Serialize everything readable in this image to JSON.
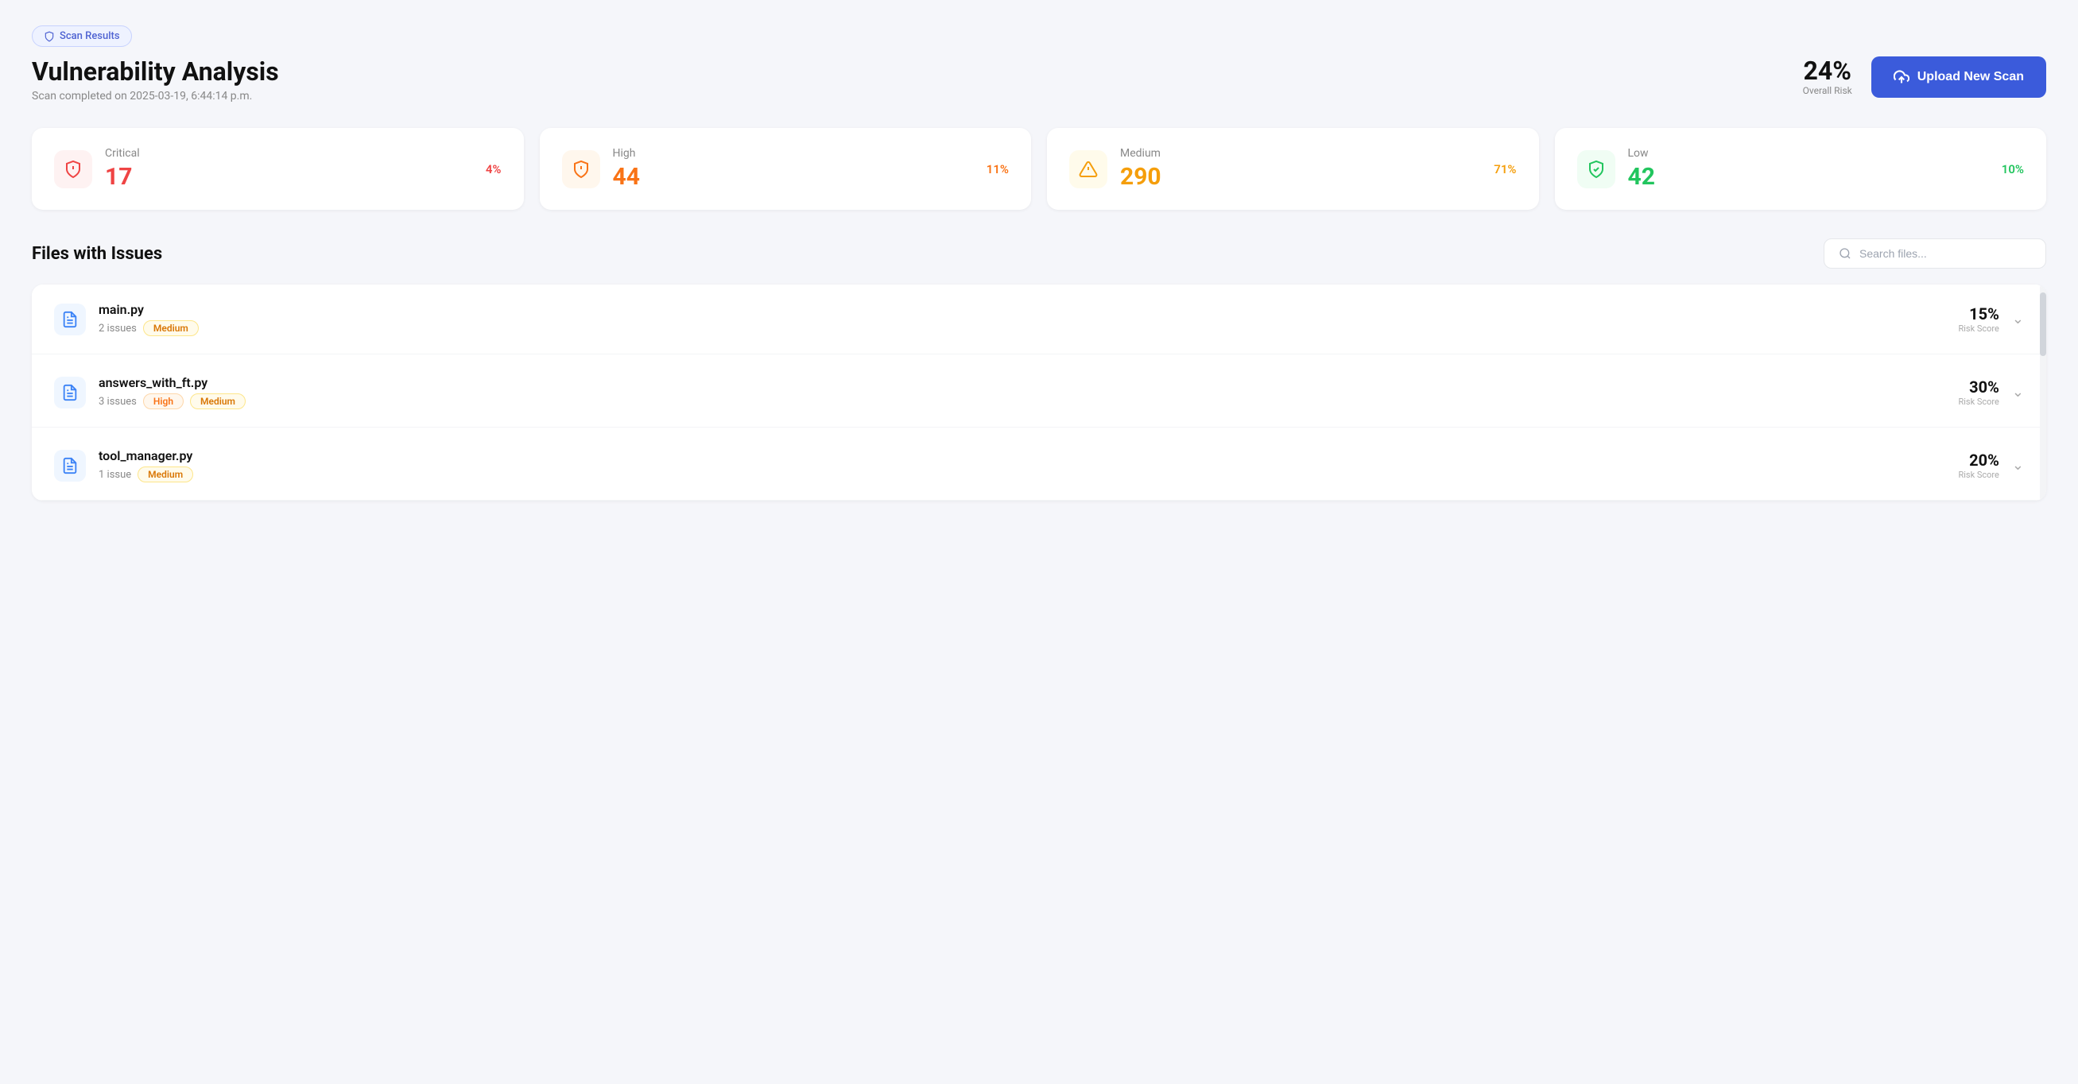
{
  "breadcrumb": {
    "label": "Scan Results",
    "icon": "shield-icon"
  },
  "header": {
    "title": "Vulnerability Analysis",
    "scan_date": "Scan completed on 2025-03-19, 6:44:14 p.m.",
    "overall_risk": {
      "percent": "24%",
      "label": "Overall Risk"
    },
    "upload_button": "Upload New Scan"
  },
  "stats": [
    {
      "label": "Critical",
      "value": "17",
      "percent": "4%",
      "severity": "critical"
    },
    {
      "label": "High",
      "value": "44",
      "percent": "11%",
      "severity": "high"
    },
    {
      "label": "Medium",
      "value": "290",
      "percent": "71%",
      "severity": "medium"
    },
    {
      "label": "Low",
      "value": "42",
      "percent": "10%",
      "severity": "low"
    }
  ],
  "files_section": {
    "title": "Files with Issues",
    "search_placeholder": "Search files...",
    "files": [
      {
        "name": "main.py",
        "issues_count": "2 issues",
        "badges": [
          "Medium"
        ],
        "risk_score": "15%",
        "risk_label": "Risk Score"
      },
      {
        "name": "answers_with_ft.py",
        "issues_count": "3 issues",
        "badges": [
          "High",
          "Medium"
        ],
        "risk_score": "30%",
        "risk_label": "Risk Score"
      },
      {
        "name": "tool_manager.py",
        "issues_count": "1 issue",
        "badges": [
          "Medium"
        ],
        "risk_score": "20%",
        "risk_label": "Risk Score"
      }
    ]
  },
  "colors": {
    "critical": "#ef4444",
    "high": "#f97316",
    "medium": "#f59e0b",
    "low": "#22c55e",
    "accent_blue": "#3b5bdb"
  }
}
